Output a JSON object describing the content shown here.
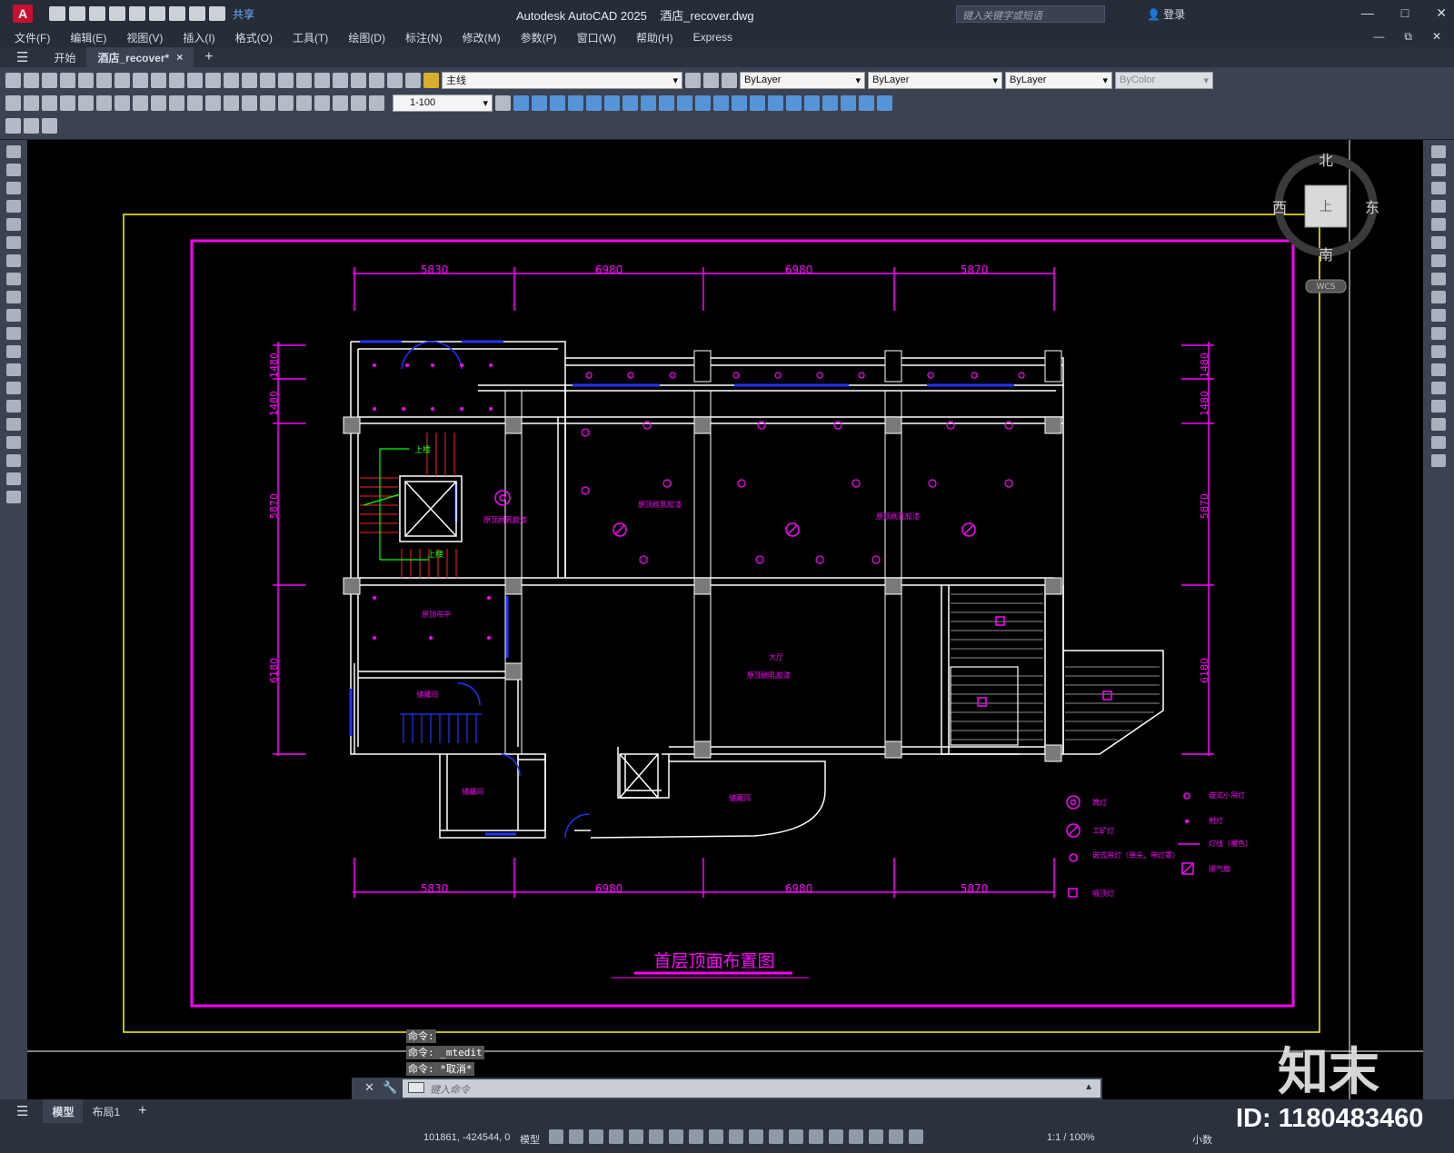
{
  "app": {
    "title": "Autodesk AutoCAD 2025",
    "file": "酒店_recover.dwg",
    "share": "共享",
    "search_placeholder": "键入关键字或短语",
    "login": "登录",
    "logo_letter": "A"
  },
  "menu": [
    "文件(F)",
    "编辑(E)",
    "视图(V)",
    "插入(I)",
    "格式(O)",
    "工具(T)",
    "绘图(D)",
    "标注(N)",
    "修改(M)",
    "参数(P)",
    "窗口(W)",
    "帮助(H)",
    "Express"
  ],
  "tabs": {
    "start": "开始",
    "doc": "酒店_recover*",
    "close": "×",
    "add": "+"
  },
  "ribbon": {
    "layer_name": "主线",
    "color_combo": "ByLayer",
    "linetype_combo": "ByLayer",
    "lineweight_combo": "ByLayer",
    "plotstyle_combo": "ByColor",
    "scale_combo": "1-100"
  },
  "viewcube": {
    "north": "北",
    "south": "南",
    "east": "东",
    "west": "西",
    "face": "上",
    "wcs": "WCS"
  },
  "drawing": {
    "title": "首层顶面布置图",
    "dims_top": [
      "5830",
      "6980",
      "6980",
      "5870"
    ],
    "dims_bottom": [
      "5830",
      "6980",
      "6980",
      "5870"
    ],
    "dims_left": [
      "1480",
      "1480",
      "5870",
      "6180"
    ],
    "dims_right": [
      "1480",
      "1480",
      "5870",
      "6180"
    ],
    "room_labels": [
      "原顶刷乳胶漆",
      "原顶刷乳胶漆",
      "原顶刷乳胶漆",
      "原顶刷乳胶漆",
      "原顶吊平",
      "原顶刷乳胶漆",
      "储藏间",
      "储藏间",
      "储藏间",
      "大厅",
      "上楼",
      "上楼"
    ],
    "legend": [
      {
        "label": "筒灯",
        "icon": "downlight-icon"
      },
      {
        "label": "工矿灯",
        "icon": "industrial-lamp-icon"
      },
      {
        "label": "嵌式吊灯（单头、带灯罩）",
        "icon": "pendant-lamp-icon"
      },
      {
        "label": "吸顶灯",
        "icon": "ceiling-lamp-icon"
      },
      {
        "label": "嵌式小吊灯",
        "icon": "small-pendant-icon"
      },
      {
        "label": "射灯",
        "icon": "spotlight-icon"
      },
      {
        "label": "灯线（暖色）",
        "icon": "light-strip-icon"
      },
      {
        "label": "排气扇",
        "icon": "exhaust-fan-icon"
      }
    ]
  },
  "command": {
    "history": [
      "命令:",
      "命令: _mtedit",
      "命令: *取消*"
    ],
    "placeholder": "键入命令"
  },
  "layout_tabs": {
    "model": "模型",
    "layout1": "布局1",
    "add": "+"
  },
  "status": {
    "coords": "101861, -424544, 0",
    "model": "模型",
    "scale": "1:1 / 100%",
    "units": "小数"
  },
  "watermark": {
    "id": "ID: 1180483460",
    "brand": "知末"
  }
}
